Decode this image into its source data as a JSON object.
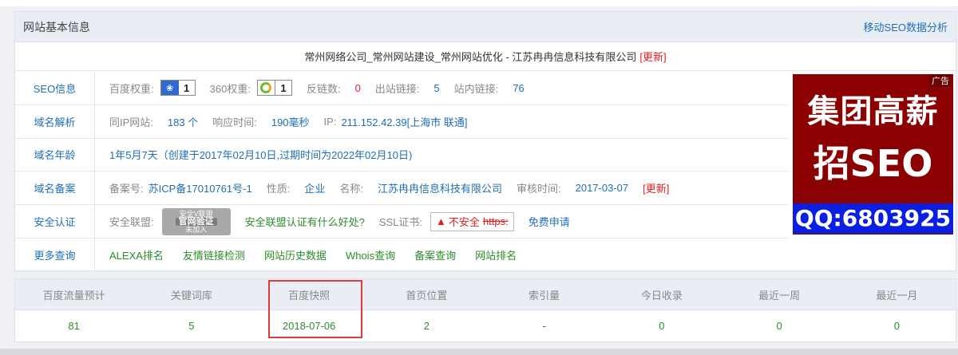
{
  "panel": {
    "title": "网站基本信息",
    "mobile_link": "移动SEO数据分析"
  },
  "site": {
    "title": "常州网络公司_常州网站建设_常州网站优化 - 江苏冉冉信息科技有限公司",
    "update": "[更新]"
  },
  "seo": {
    "label": "SEO信息",
    "baidu_weight_k": "百度权重:",
    "baidu_weight_v": "1",
    "weight360_k": "360权重:",
    "weight360_v": "1",
    "backlinks_k": "反链数:",
    "backlinks_v": "0",
    "outlinks_k": "出站链接:",
    "outlinks_v": "5",
    "inlinks_k": "站内链接:",
    "inlinks_v": "76"
  },
  "dns": {
    "label": "域名解析",
    "same_ip_k": "同IP网站:",
    "same_ip_v": "183 个",
    "resp_k": "响应时间:",
    "resp_v": "190毫秒",
    "ip_k": "IP:",
    "ip_v": "211.152.42.39[上海市 联通]"
  },
  "age": {
    "label": "域名年龄",
    "value": "1年5月7天（创建于2017年02月10日,过期时间为2022年02月10日)"
  },
  "icp": {
    "label": "域名备案",
    "no_k": "备案号:",
    "no_v": "苏ICP备17010761号-1",
    "type_k": "性质:",
    "type_v": "企业",
    "name_k": "名称:",
    "name_v": "江苏冉冉信息科技有限公司",
    "date_k": "审核时间:",
    "date_v": "2017-03-07",
    "update": "[更新]"
  },
  "security": {
    "label": "安全认证",
    "alliance_k": "安全联盟:",
    "seal_top": "安全V联盟",
    "seal_main": "官网验证",
    "seal_bottom": "未加入",
    "alliance_link": "安全联盟认证有什么好处?",
    "ssl_k": "SSL证书:",
    "ssl_badge": "不安全",
    "ssl_proto": "https:",
    "ssl_apply": "免费申请"
  },
  "more": {
    "label": "更多查询",
    "links": [
      "ALEXA排名",
      "友情链接检测",
      "网站历史数据",
      "Whois查询",
      "备案查询",
      "网站排名"
    ]
  },
  "ad": {
    "tag": "广告",
    "line1": "集团高薪",
    "line2": "招SEO",
    "qq": "QQ:6803925"
  },
  "stats": {
    "headers": [
      "百度流量预计",
      "关键词库",
      "百度快照",
      "首页位置",
      "索引量",
      "今日收录",
      "最近一周",
      "最近一月"
    ],
    "values": [
      "81",
      "5",
      "2018-07-06",
      "2",
      "-",
      "0",
      "0",
      "0"
    ]
  },
  "colors": {
    "link_blue": "#1f6fb5",
    "green": "#2e8b2e",
    "red": "#e02020",
    "ad_bg": "#8b0000",
    "ad_qq_bg": "#0a1fe0",
    "highlight": "#e23a3a"
  }
}
